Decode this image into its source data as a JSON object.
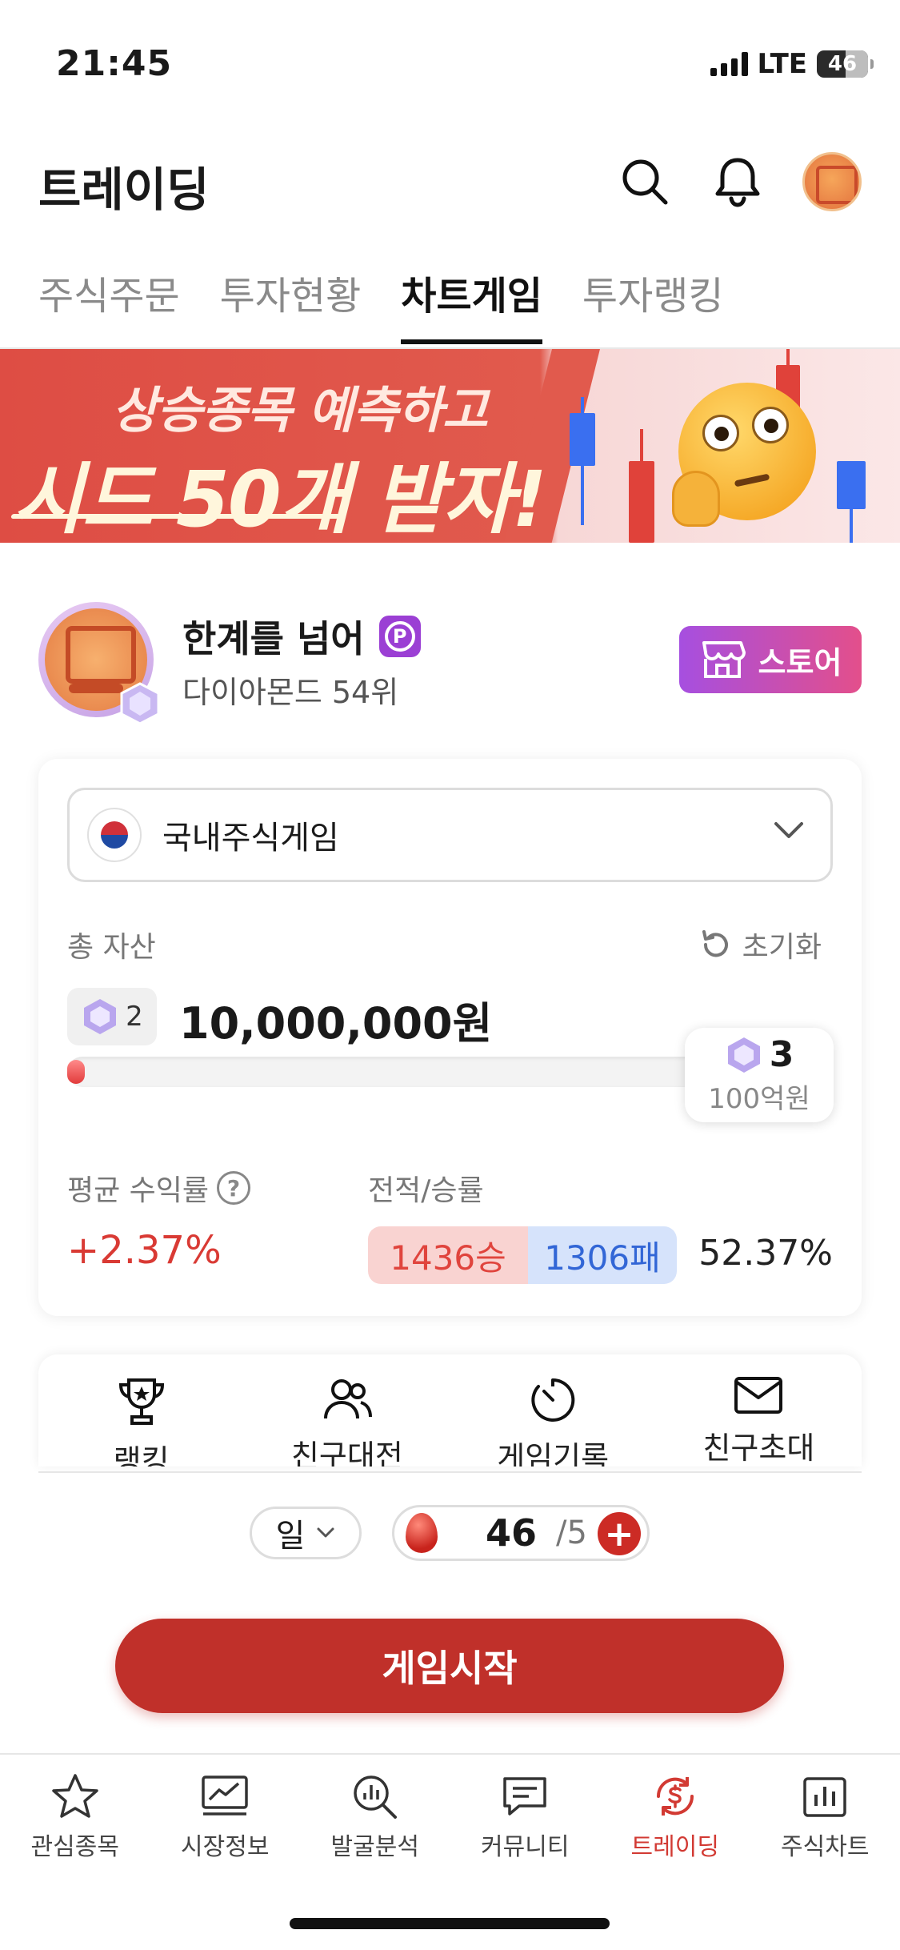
{
  "status_bar": {
    "time": "21:45",
    "network": "LTE",
    "battery": "46"
  },
  "header": {
    "title": "트레이딩",
    "icons": [
      "search-icon",
      "bell-icon",
      "profile-avatar"
    ]
  },
  "tabs": [
    {
      "label": "주식주문",
      "active": false
    },
    {
      "label": "투자현황",
      "active": false
    },
    {
      "label": "차트게임",
      "active": true
    },
    {
      "label": "투자랭킹",
      "active": false
    }
  ],
  "banner": {
    "line1": "상승종목 예측하고",
    "line2": "시드 50개 받자!"
  },
  "profile": {
    "name": "한계를 넘어",
    "badge": "P",
    "rank": "다이아몬드 54위",
    "store_label": "스토어"
  },
  "game": {
    "market_select": "국내주식게임",
    "total_assets_label": "총 자산",
    "reset_label": "초기화",
    "current_gem_level": "2",
    "amount": "10,000,000원",
    "progress": 0.01,
    "goal_gem_level": "3",
    "goal_amount": "100억원",
    "avg_return_label": "평균 수익률",
    "avg_return": "+2.37%",
    "record_label": "전적/승률",
    "wins": "1436승",
    "losses": "1306패",
    "win_rate": "52.37%"
  },
  "menu": [
    {
      "label": "랭킹",
      "icon": "trophy-icon"
    },
    {
      "label": "친구대전",
      "icon": "friends-icon"
    },
    {
      "label": "게임기록",
      "icon": "timer-icon"
    },
    {
      "label": "친구초대",
      "icon": "mail-icon"
    }
  ],
  "controls": {
    "period": "일",
    "seeds": "46",
    "seeds_max": "/5",
    "start_label": "게임시작"
  },
  "bottom_nav": [
    {
      "label": "관심종목",
      "icon": "star-icon",
      "active": false
    },
    {
      "label": "시장정보",
      "icon": "market-chart-icon",
      "active": false
    },
    {
      "label": "발굴분석",
      "icon": "analysis-search-icon",
      "active": false
    },
    {
      "label": "커뮤니티",
      "icon": "chat-icon",
      "active": false
    },
    {
      "label": "트레이딩",
      "icon": "trading-icon",
      "active": true
    },
    {
      "label": "주식차트",
      "icon": "bar-chart-icon",
      "active": false
    }
  ],
  "colors": {
    "accent": "#c0302a",
    "win": "#e0443d",
    "loss": "#3266d6",
    "store_gradient_start": "#a64fe0",
    "store_gradient_end": "#e34f8b"
  }
}
